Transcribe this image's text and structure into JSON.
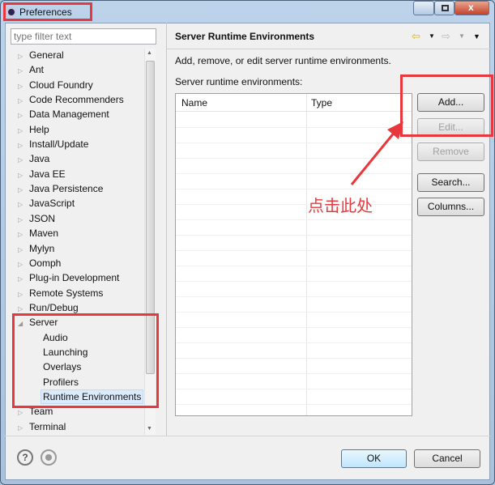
{
  "window": {
    "title": "Preferences"
  },
  "filter": {
    "placeholder": "type filter text"
  },
  "tree": {
    "items": [
      {
        "label": "General"
      },
      {
        "label": "Ant"
      },
      {
        "label": "Cloud Foundry"
      },
      {
        "label": "Code Recommenders"
      },
      {
        "label": "Data Management"
      },
      {
        "label": "Help"
      },
      {
        "label": "Install/Update"
      },
      {
        "label": "Java"
      },
      {
        "label": "Java EE"
      },
      {
        "label": "Java Persistence"
      },
      {
        "label": "JavaScript"
      },
      {
        "label": "JSON"
      },
      {
        "label": "Maven"
      },
      {
        "label": "Mylyn"
      },
      {
        "label": "Oomph"
      },
      {
        "label": "Plug-in Development"
      },
      {
        "label": "Remote Systems"
      },
      {
        "label": "Run/Debug"
      },
      {
        "label": "Server"
      }
    ],
    "server_children": [
      "Audio",
      "Launching",
      "Overlays",
      "Profilers",
      "Runtime Environments"
    ],
    "after": [
      "Team",
      "Terminal"
    ],
    "selected": "Runtime Environments"
  },
  "page": {
    "title": "Server Runtime Environments",
    "description": "Add, remove, or edit server runtime environments.",
    "list_label": "Server runtime environments:",
    "columns": [
      "Name",
      "Type"
    ],
    "buttons": {
      "add": "Add...",
      "edit": "Edit...",
      "remove": "Remove",
      "search": "Search...",
      "columns": "Columns..."
    }
  },
  "annotation": {
    "text": "点击此处",
    "color": "#e8383d"
  },
  "footer": {
    "ok": "OK",
    "cancel": "Cancel"
  }
}
